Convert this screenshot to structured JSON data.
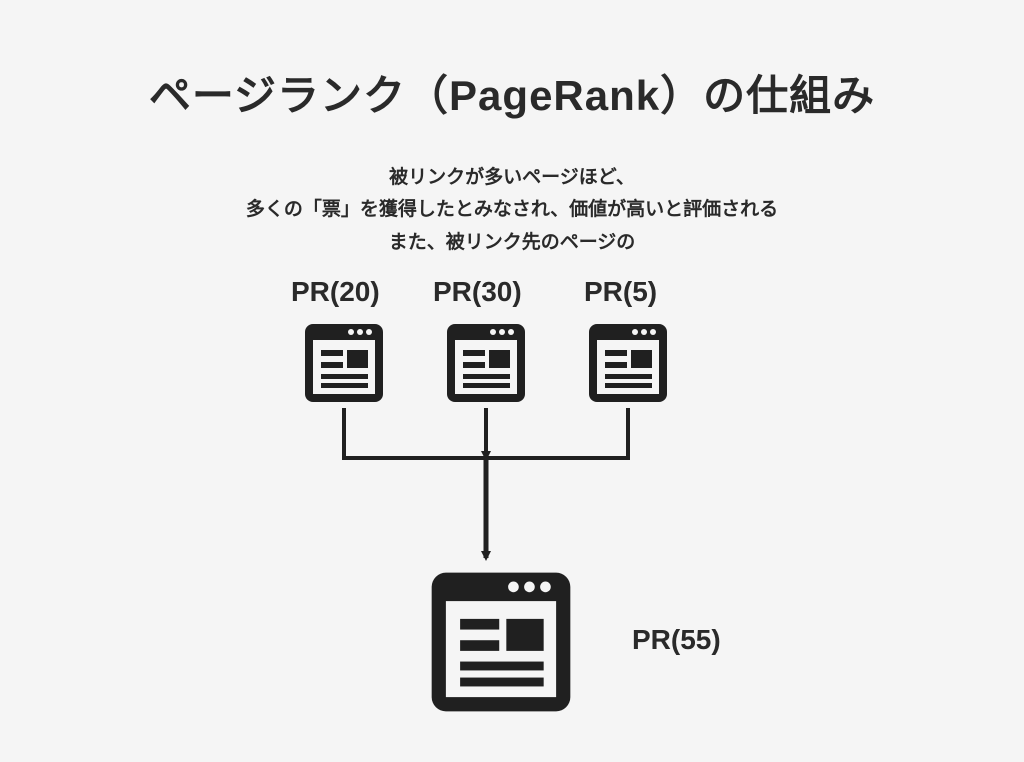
{
  "title": "ページランク（PageRank）の仕組み",
  "description": {
    "line1": "被リンクが多いページほど、",
    "line2": "多くの「票」を獲得したとみなされ、価値が高いと評価される",
    "line3": "また、被リンク先のページの"
  },
  "nodes": {
    "top1": {
      "label": "PR(20)"
    },
    "top2": {
      "label": "PR(30)"
    },
    "top3": {
      "label": "PR(5)"
    },
    "bottom": {
      "label": "PR(55)"
    }
  },
  "chart_data": {
    "type": "diagram",
    "description": "PageRank flow diagram: three source pages with PR values link into one target page; the target accumulates their contributions.",
    "nodes": [
      {
        "id": "A",
        "label": "PR(20)",
        "value": 20
      },
      {
        "id": "B",
        "label": "PR(30)",
        "value": 30
      },
      {
        "id": "C",
        "label": "PR(5)",
        "value": 5
      },
      {
        "id": "T",
        "label": "PR(55)",
        "value": 55
      }
    ],
    "edges": [
      {
        "from": "A",
        "to": "T"
      },
      {
        "from": "B",
        "to": "T"
      },
      {
        "from": "C",
        "to": "T"
      }
    ]
  }
}
